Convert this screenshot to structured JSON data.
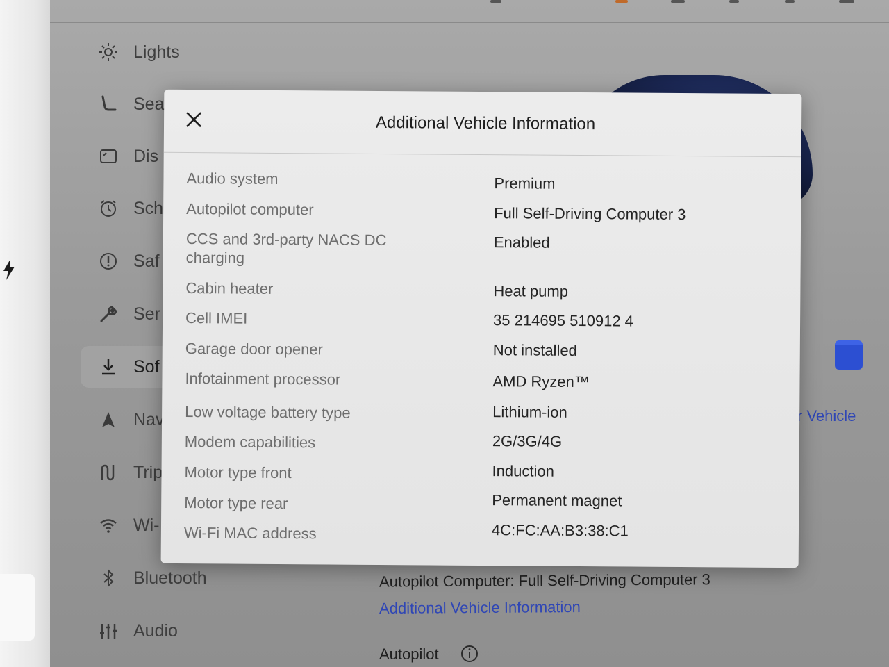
{
  "sidebar": {
    "items": [
      {
        "label": "Lights",
        "icon": "lights-icon"
      },
      {
        "label": "Sea",
        "icon": "seat-icon"
      },
      {
        "label": "Dis",
        "icon": "display-icon"
      },
      {
        "label": "Sch",
        "icon": "schedule-icon"
      },
      {
        "label": "Saf",
        "icon": "safety-icon"
      },
      {
        "label": "Ser",
        "icon": "wrench-icon"
      },
      {
        "label": "Sof",
        "icon": "download-icon"
      },
      {
        "label": "Nav",
        "icon": "navigation-icon"
      },
      {
        "label": "Trip",
        "icon": "trips-icon"
      },
      {
        "label": "Wi-",
        "icon": "wifi-icon"
      },
      {
        "label": "Bluetooth",
        "icon": "bluetooth-icon"
      },
      {
        "label": "Audio",
        "icon": "audio-icon"
      }
    ],
    "active_index": 6
  },
  "background": {
    "vehicle_link_partial": "r Vehicle",
    "autopilot_computer_line": "Autopilot Computer: Full Self-Driving Computer 3",
    "additional_info_link": "Additional Vehicle Information",
    "autopilot_heading": "Autopilot"
  },
  "modal": {
    "title": "Additional Vehicle Information",
    "close_icon": "close-icon",
    "rows": [
      {
        "label": "Audio system",
        "value": "Premium"
      },
      {
        "label": "Autopilot computer",
        "value": "Full Self-Driving Computer 3"
      },
      {
        "label": "CCS and 3rd-party NACS DC charging",
        "value": "Enabled"
      },
      {
        "label": "Cabin heater",
        "value": "Heat pump"
      },
      {
        "label": "Cell IMEI",
        "value": "35 214695 510912 4"
      },
      {
        "label": "Garage door opener",
        "value": "Not installed"
      },
      {
        "label": "Infotainment processor",
        "value": "AMD Ryzen™"
      },
      {
        "label": "Low voltage battery type",
        "value": "Lithium-ion"
      },
      {
        "label": "Modem capabilities",
        "value": "2G/3G/4G"
      },
      {
        "label": "Motor type front",
        "value": "Induction"
      },
      {
        "label": "Motor type rear",
        "value": "Permanent magnet"
      },
      {
        "label": "Wi-Fi MAC address",
        "value": "4C:FC:AA:B3:38:C1"
      }
    ]
  }
}
